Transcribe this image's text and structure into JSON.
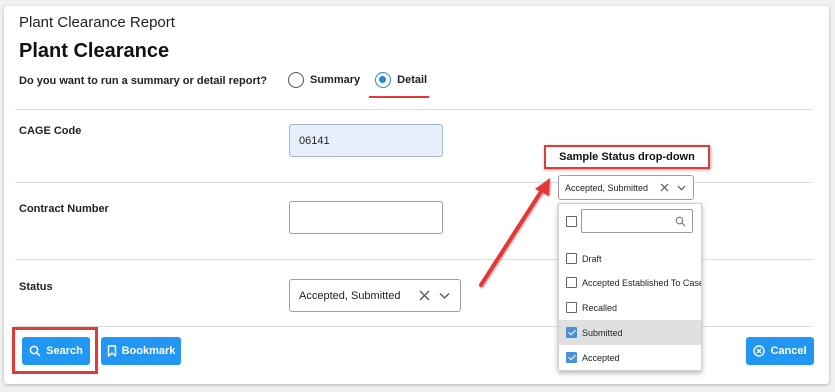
{
  "header": {
    "report_title": "Plant Clearance Report",
    "page_title": "Plant Clearance"
  },
  "report_type": {
    "question": "Do you want to run a summary or detail report?",
    "options": [
      {
        "label": "Summary",
        "selected": false
      },
      {
        "label": "Detail",
        "selected": true
      }
    ]
  },
  "fields": {
    "cage_code": {
      "label": "CAGE Code",
      "value": "06141"
    },
    "contract_number": {
      "label": "Contract Number",
      "value": ""
    },
    "status": {
      "label": "Status",
      "value": "Accepted, Submitted"
    }
  },
  "buttons": {
    "search": "Search",
    "bookmark": "Bookmark",
    "cancel": "Cancel"
  },
  "annotation": {
    "callout": "Sample Status drop-down",
    "sample_value": "Accepted, Submitted",
    "options": [
      {
        "label": "Draft",
        "checked": false
      },
      {
        "label": "Accepted Established To Case",
        "checked": false
      },
      {
        "label": "Recalled",
        "checked": false
      },
      {
        "label": "Submitted",
        "checked": true
      },
      {
        "label": "Accepted",
        "checked": true
      }
    ]
  },
  "colors": {
    "accent": "#2196f3",
    "annotation_red": "#e53935",
    "cage_input_bg": "#e8effc"
  }
}
